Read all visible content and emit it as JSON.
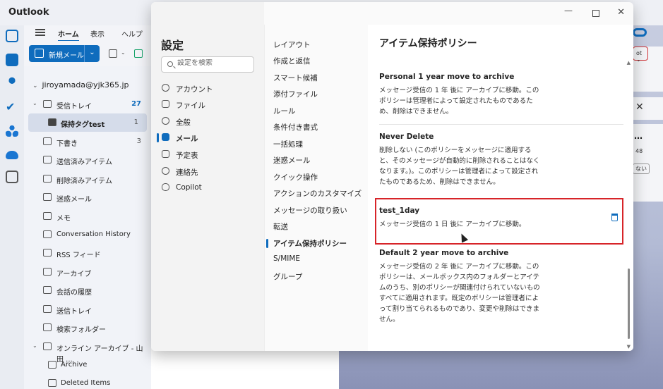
{
  "app": {
    "title": "Outlook"
  },
  "ribbon": {
    "tabs": [
      "ホーム",
      "表示",
      "ヘルプ"
    ],
    "new_mail_label": "新規メール"
  },
  "folders": {
    "account": "jiroyamada@yjk365.jp",
    "items": [
      {
        "label": "受信トレイ",
        "count": "27"
      },
      {
        "label": "保持タグtest",
        "count": "1"
      },
      {
        "label": "下書き",
        "count": "3"
      },
      {
        "label": "送信済みアイテム",
        "count": ""
      },
      {
        "label": "削除済みアイテム",
        "count": ""
      },
      {
        "label": "迷惑メール",
        "count": ""
      },
      {
        "label": "メモ",
        "count": ""
      },
      {
        "label": "Conversation History",
        "count": ""
      },
      {
        "label": "RSS フィード",
        "count": ""
      },
      {
        "label": "アーカイブ",
        "count": ""
      },
      {
        "label": "会話の履歴",
        "count": ""
      },
      {
        "label": "送信トレイ",
        "count": ""
      },
      {
        "label": "検索フォルダー",
        "count": ""
      },
      {
        "label": "オンライン アーカイブ - 山田 ...",
        "count": ""
      },
      {
        "label": "Archive",
        "count": ""
      },
      {
        "label": "Deleted Items",
        "count": ""
      }
    ]
  },
  "reading_pane": {
    "options_btn": "ot",
    "time_text": "48",
    "small_btn": "ない"
  },
  "settings": {
    "title": "設定",
    "search_placeholder": "設定を検索",
    "categories": [
      {
        "label": "アカウント",
        "icon": "person-icon"
      },
      {
        "label": "ファイル",
        "icon": "attach-icon"
      },
      {
        "label": "全般",
        "icon": "gear-icon"
      },
      {
        "label": "メール",
        "icon": "mail-icon"
      },
      {
        "label": "予定表",
        "icon": "calendar-icon"
      },
      {
        "label": "連絡先",
        "icon": "people-icon"
      },
      {
        "label": "Copilot",
        "icon": "copilot-icon"
      }
    ],
    "subcategories": [
      "レイアウト",
      "作成と返信",
      "スマート候補",
      "添付ファイル",
      "ルール",
      "条件付き書式",
      "一括処理",
      "迷惑メール",
      "クイック操作",
      "アクションのカスタマイズ",
      "メッセージの取り扱い",
      "転送",
      "アイテム保持ポリシー",
      "S/MIME",
      "グループ"
    ],
    "content_title": "アイテム保持ポリシー",
    "policies": [
      {
        "name": "Personal 1 year move to archive",
        "description": "メッセージ受信の 1 年 後に アーカイブに移動。このポリシーは管理者によって設定されたものであるため、削除はできません。"
      },
      {
        "name": "Never Delete",
        "description": "削除しない (このポリシーをメッセージに適用すると、そのメッセージが自動的に削除されることはなくなります。)。このポリシーは管理者によって設定されたものであるため、削除はできません。"
      },
      {
        "name": "test_1day",
        "description": "メッセージ受信の 1 日 後に アーカイブに移動。"
      },
      {
        "name": "Default 2 year move to archive",
        "description": "メッセージ受信の 2 年 後に アーカイブに移動。このポリシーは、メールボックス内のフォルダーとアイテムのうち、別のポリシーが関連付けられていないものすべてに適用されます。既定のポリシーは管理者によって割り当てられるものであり、変更や削除はできません。"
      }
    ]
  },
  "colors": {
    "accent": "#0f6cbd",
    "highlight_border": "#d72429"
  }
}
